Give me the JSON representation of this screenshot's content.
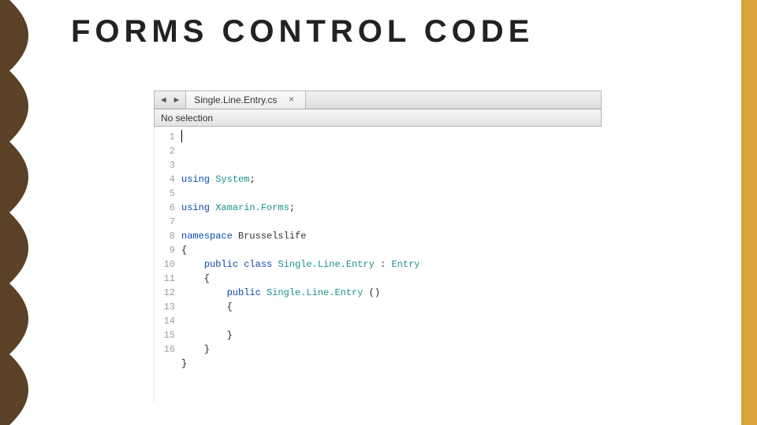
{
  "title": "FORMS CONTROL CODE",
  "tab": {
    "name": "Single.Line.Entry.cs",
    "close_glyph": "×",
    "nav_prev": "◀",
    "nav_next": "▶"
  },
  "breadcrumb": "No selection",
  "code": {
    "line_numbers": [
      "1",
      "2",
      "3",
      "4",
      "5",
      "6",
      "7",
      "8",
      "9",
      "10",
      "11",
      "12",
      "13",
      "14",
      "15",
      "16"
    ],
    "lines": [
      [
        {
          "t": "using ",
          "c": "kw"
        },
        {
          "t": "System",
          "c": "type"
        },
        {
          "t": ";",
          "c": "plain"
        }
      ],
      [
        {
          "t": "",
          "c": "plain"
        }
      ],
      [
        {
          "t": "using ",
          "c": "kw"
        },
        {
          "t": "Xamarin.Forms",
          "c": "type"
        },
        {
          "t": ";",
          "c": "plain"
        }
      ],
      [
        {
          "t": "",
          "c": "plain"
        }
      ],
      [
        {
          "t": "namespace ",
          "c": "kw"
        },
        {
          "t": "Brusselslife",
          "c": "ns"
        }
      ],
      [
        {
          "t": "{",
          "c": "plain"
        }
      ],
      [
        {
          "t": "    ",
          "c": "plain"
        },
        {
          "t": "public class ",
          "c": "kw"
        },
        {
          "t": "Single.Line.Entry",
          "c": "type"
        },
        {
          "t": " : ",
          "c": "plain"
        },
        {
          "t": "Entry",
          "c": "type"
        }
      ],
      [
        {
          "t": "    {",
          "c": "plain"
        }
      ],
      [
        {
          "t": "        ",
          "c": "plain"
        },
        {
          "t": "public ",
          "c": "kw"
        },
        {
          "t": "Single.Line.Entry",
          "c": "type"
        },
        {
          "t": " ()",
          "c": "plain"
        }
      ],
      [
        {
          "t": "        {",
          "c": "plain"
        }
      ],
      [
        {
          "t": "",
          "c": "plain"
        }
      ],
      [
        {
          "t": "        }",
          "c": "plain"
        }
      ],
      [
        {
          "t": "    }",
          "c": "plain"
        }
      ],
      [
        {
          "t": "}",
          "c": "plain"
        }
      ],
      [
        {
          "t": "",
          "c": "plain"
        }
      ],
      [
        {
          "t": "",
          "c": "plain"
        }
      ]
    ]
  }
}
